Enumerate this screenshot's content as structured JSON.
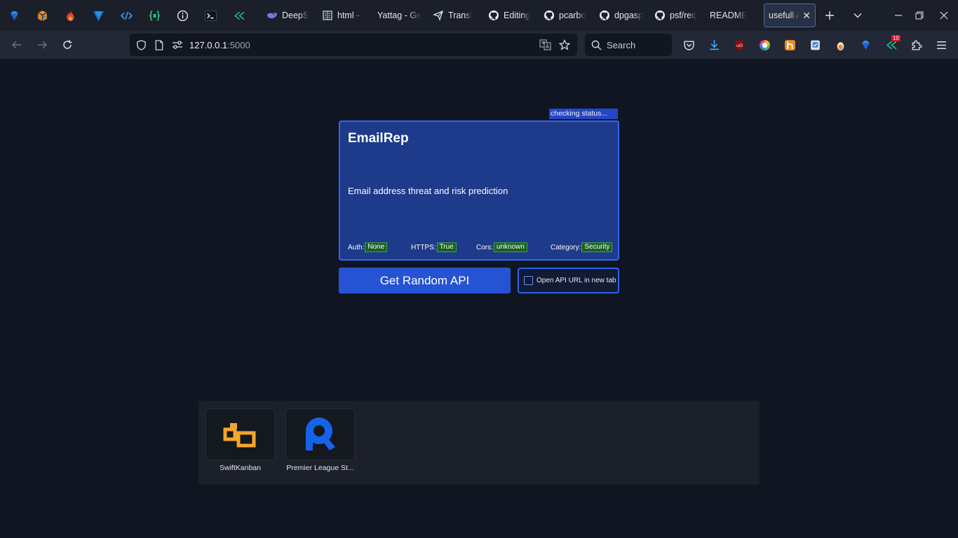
{
  "browser": {
    "tabs": [
      {
        "label": "DeepS",
        "icon": "deepseek-icon"
      },
      {
        "label": "html –",
        "icon": "book-icon"
      },
      {
        "label": "Yattag - Ge",
        "icon": "none"
      },
      {
        "label": "Transl",
        "icon": "send-icon"
      },
      {
        "label": "Editing",
        "icon": "github-icon"
      },
      {
        "label": "pcarbo",
        "icon": "github-icon"
      },
      {
        "label": "dpgasp",
        "icon": "github-icon"
      },
      {
        "label": "psf/req",
        "icon": "github-icon"
      },
      {
        "label": "README",
        "icon": "none"
      }
    ],
    "active_tab": {
      "label": "usefull AP"
    },
    "url_host": "127.0.0.1",
    "url_port": ":5000",
    "search_placeholder": "Search",
    "ext_badge": "10"
  },
  "page": {
    "status": "checking status...",
    "card": {
      "title": "EmailRep",
      "description": "Email address threat and risk prediction",
      "auth_label": "Auth:",
      "auth_value": "None",
      "https_label": "HTTPS:",
      "https_value": "True",
      "cors_label": "Cors:",
      "cors_value": "unknown",
      "category_label": "Category:",
      "category_value": "Security"
    },
    "get_button": "Get Random API",
    "new_tab_option": "Open API URL in new tab",
    "new_tab_checked": false
  },
  "shortcuts": [
    {
      "name": "SwiftKanban",
      "icon": "swiftkanban-logo-icon"
    },
    {
      "name": "Premier League St...",
      "icon": "premier-league-logo-icon"
    }
  ],
  "colors": {
    "page_bg": "#0f1622",
    "card_bg": "#1e3a8a",
    "card_border": "#3566f4",
    "button_bg": "#2553d4",
    "badge_green": "#1b5e20"
  }
}
